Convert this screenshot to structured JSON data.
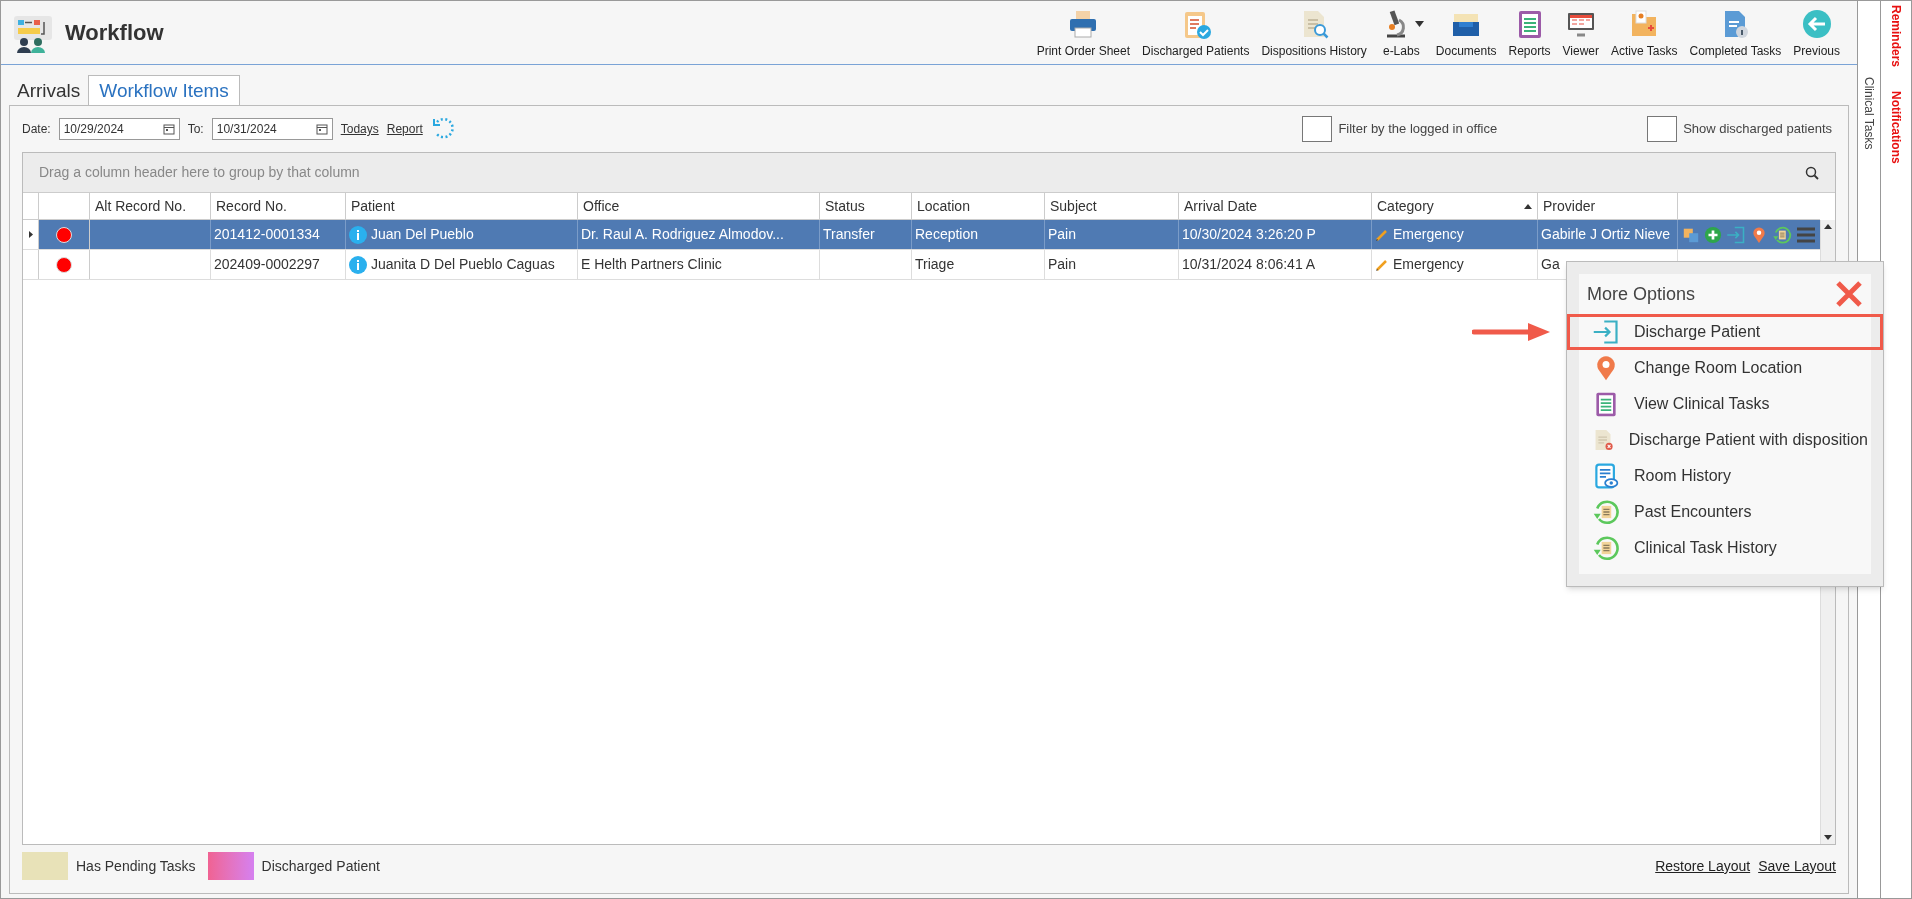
{
  "header": {
    "title": "Workflow",
    "toolbar": [
      {
        "label": "Print Order Sheet",
        "kind": "printer",
        "dropdown": false
      },
      {
        "label": "Discharged Patients",
        "kind": "clipboard-check",
        "dropdown": false
      },
      {
        "label": "Dispositions History",
        "kind": "doc-search",
        "dropdown": false
      },
      {
        "label": "e-Labs",
        "kind": "microscope",
        "dropdown": true
      },
      {
        "label": "Documents",
        "kind": "tray",
        "dropdown": false
      },
      {
        "label": "Reports",
        "kind": "clipboard-list",
        "dropdown": false
      },
      {
        "label": "Viewer",
        "kind": "monitor",
        "dropdown": false
      },
      {
        "label": "Active Tasks",
        "kind": "folder",
        "dropdown": false
      },
      {
        "label": "Completed Tasks",
        "kind": "doc-info",
        "dropdown": false
      },
      {
        "label": "Previous",
        "kind": "back",
        "dropdown": false
      }
    ]
  },
  "side_panels": [
    {
      "label": "Clinical Tasks",
      "alert": false
    },
    {
      "label": "Reminders",
      "alert": true
    },
    {
      "label": "Notifications",
      "alert": true
    }
  ],
  "tabs": [
    {
      "label": "Arrivals",
      "selected": false
    },
    {
      "label": "Workflow Items",
      "selected": true
    }
  ],
  "filters": {
    "date_label": "Date:",
    "date_from": "10/29/2024",
    "to_label": "To:",
    "date_to": "10/31/2024",
    "links": [
      "Todays",
      "Report"
    ],
    "checkboxes": [
      {
        "label": "Filter by the logged in office",
        "checked": false
      },
      {
        "label": "Show discharged patients",
        "checked": false
      }
    ]
  },
  "grid": {
    "group_panel": "Drag a column header here to group by that column",
    "columns": [
      {
        "label": "Alt Record No.",
        "sorted": false
      },
      {
        "label": "Record No.",
        "sorted": false
      },
      {
        "label": "Patient",
        "sorted": false
      },
      {
        "label": "Office",
        "sorted": false
      },
      {
        "label": "Status",
        "sorted": false
      },
      {
        "label": "Location",
        "sorted": false
      },
      {
        "label": "Subject",
        "sorted": false
      },
      {
        "label": "Arrival Date",
        "sorted": false
      },
      {
        "label": "Category",
        "sorted": true
      },
      {
        "label": "Provider",
        "sorted": false
      }
    ],
    "rows": [
      {
        "selected": true,
        "color": "#ff0000",
        "alt_record": "",
        "record": "201412-0001334",
        "patient": "Juan Del Pueblo",
        "office": "Dr. Raul A. Rodriguez Almodov...",
        "status": "Transfer",
        "location": "Reception",
        "subject": "Pain",
        "arrival": "10/30/2024 3:26:20 P",
        "category": "Emergency",
        "provider": "Gabirle J Ortiz Nieve",
        "actions": true
      },
      {
        "selected": false,
        "color": "#ff0000",
        "alt_record": "",
        "record": "202409-0002297",
        "patient": "Juanita D Del Pueblo Caguas",
        "office": "E Helth Partners Clinic",
        "status": "",
        "location": "Triage",
        "subject": "Pain",
        "arrival": "10/31/2024 8:06:41 A",
        "category": "Emergency",
        "provider": "Ga",
        "actions": false
      }
    ]
  },
  "legend": [
    {
      "label": "Has Pending Tasks",
      "kind": "pending"
    },
    {
      "label": "Discharged Patient",
      "kind": "discharged"
    }
  ],
  "layout_links": [
    "Restore Layout",
    "Save Layout"
  ],
  "popup": {
    "title": "More Options",
    "items": [
      {
        "label": "Discharge Patient",
        "kind": "enter",
        "highlighted": true
      },
      {
        "label": "Change Room Location",
        "kind": "pin",
        "highlighted": false
      },
      {
        "label": "View Clinical Tasks",
        "kind": "clipboard",
        "highlighted": false
      },
      {
        "label": "Discharge Patient with disposition",
        "kind": "doc-x",
        "highlighted": false
      },
      {
        "label": "Room History",
        "kind": "doc-eye",
        "highlighted": false
      },
      {
        "label": "Past Encounters",
        "kind": "history",
        "highlighted": false
      },
      {
        "label": "Clinical Task History",
        "kind": "history",
        "highlighted": false
      }
    ]
  }
}
